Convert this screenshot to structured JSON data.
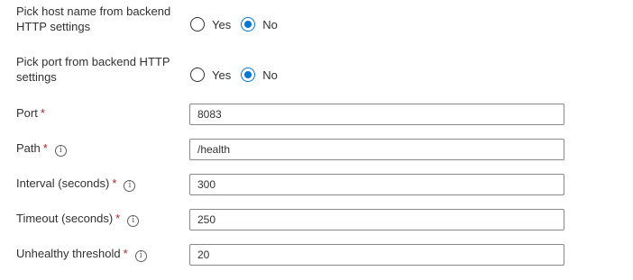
{
  "form": {
    "pick_host": {
      "label": "Pick host name from backend HTTP settings",
      "options": [
        {
          "label": "Yes",
          "checked": false
        },
        {
          "label": "No",
          "checked": true
        }
      ]
    },
    "pick_port": {
      "label": "Pick port from backend HTTP settings",
      "options": [
        {
          "label": "Yes",
          "checked": false
        },
        {
          "label": "No",
          "checked": true
        }
      ]
    },
    "port": {
      "label": "Port",
      "required": "*",
      "value": "8083"
    },
    "path": {
      "label": "Path",
      "required": "*",
      "info": "i",
      "value": "/health"
    },
    "interval": {
      "label": "Interval (seconds)",
      "required": "*",
      "info": "i",
      "value": "300"
    },
    "timeout": {
      "label": "Timeout (seconds)",
      "required": "*",
      "info": "i",
      "value": "250"
    },
    "unhealthy": {
      "label": "Unhealthy threshold",
      "required": "*",
      "info": "i",
      "value": "20"
    }
  },
  "colors": {
    "accent": "#0078d4",
    "required": "#a4262c",
    "text": "#323130",
    "border": "#8a8886"
  }
}
